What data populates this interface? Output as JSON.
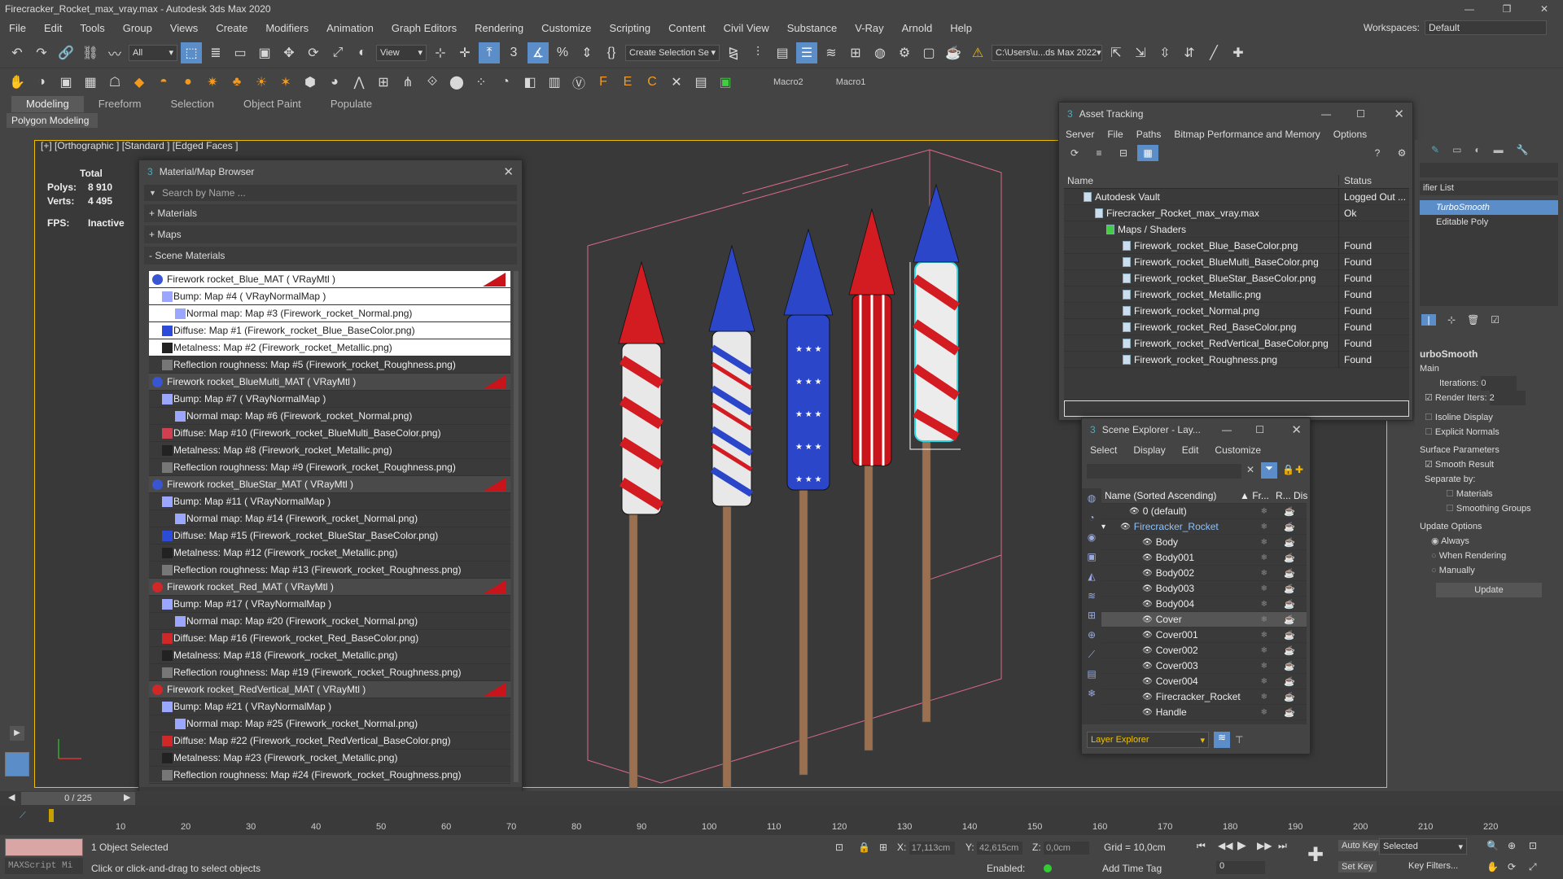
{
  "titlebar": {
    "title": "Firecracker_Rocket_max_vray.max - Autodesk 3ds Max 2020"
  },
  "menu": {
    "items": [
      "File",
      "Edit",
      "Tools",
      "Group",
      "Views",
      "Create",
      "Modifiers",
      "Animation",
      "Graph Editors",
      "Rendering",
      "Customize",
      "Scripting",
      "Content",
      "Civil View",
      "Substance",
      "V-Ray",
      "Arnold",
      "Help"
    ],
    "workspaces_label": "Workspaces:",
    "workspaces_value": "Default"
  },
  "toolbar": {
    "filter_value": "All",
    "view_value": "View",
    "selection_set_value": "Create Selection Se",
    "path_value": "C:\\Users\\u...ds Max 2022",
    "macro2": "Macro2",
    "macro1": "Macro1"
  },
  "ribbon": {
    "tabs": [
      "Modeling",
      "Freeform",
      "Selection",
      "Object Paint",
      "Populate"
    ],
    "sub_label": "Polygon Modeling"
  },
  "viewport": {
    "label": "[+] [Orthographic ] [Standard ] [Edged Faces ]",
    "stats": {
      "total_label": "Total",
      "polys_label": "Polys:",
      "polys": "8 910",
      "verts_label": "Verts:",
      "verts": "4 495",
      "fps_label": "FPS:",
      "fps": "Inactive"
    }
  },
  "material_browser": {
    "title": "Material/Map Browser",
    "search_placeholder": "Search by Name ...",
    "sections": [
      "+ Materials",
      "+ Maps",
      "- Scene Materials"
    ],
    "rows": [
      {
        "level": "mat",
        "text": "Firework rocket_Blue_MAT  ( VRayMtl )",
        "color": "#3a55d0",
        "hi": true
      },
      {
        "level": "lvl1",
        "text": "Bump: Map #4  ( VRayNormalMap )",
        "color": "#9aa6ff",
        "hi": true
      },
      {
        "level": "lvl2",
        "text": "Normal map: Map #3 (Firework_rocket_Normal.png)",
        "color": "#9aa6ff",
        "hi": true
      },
      {
        "level": "lvl1",
        "text": "Diffuse: Map #1 (Firework_rocket_Blue_BaseColor.png)",
        "color": "#2c4bd8",
        "hi": true
      },
      {
        "level": "lvl1",
        "text": "Metalness: Map #2 (Firework_rocket_Metallic.png)",
        "color": "#222222",
        "hi": true
      },
      {
        "level": "lvl1",
        "text": "Reflection roughness: Map #5 (Firework_rocket_Roughness.png)",
        "color": "#777777",
        "hi": false
      },
      {
        "level": "mat",
        "text": "Firework rocket_BlueMulti_MAT  ( VRayMtl )",
        "color": "#3a55d0",
        "hi": false
      },
      {
        "level": "lvl1",
        "text": "Bump: Map #7  ( VRayNormalMap )",
        "color": "#9aa6ff",
        "hi": false
      },
      {
        "level": "lvl2",
        "text": "Normal map: Map #6 (Firework_rocket_Normal.png)",
        "color": "#9aa6ff",
        "hi": false
      },
      {
        "level": "lvl1",
        "text": "Diffuse: Map #10 (Firework_rocket_BlueMulti_BaseColor.png)",
        "color": "#d04050",
        "hi": false
      },
      {
        "level": "lvl1",
        "text": "Metalness: Map #8 (Firework_rocket_Metallic.png)",
        "color": "#222222",
        "hi": false
      },
      {
        "level": "lvl1",
        "text": "Reflection roughness: Map #9 (Firework_rocket_Roughness.png)",
        "color": "#777777",
        "hi": false
      },
      {
        "level": "mat",
        "text": "Firework rocket_BlueStar_MAT  ( VRayMtl )",
        "color": "#3a55d0",
        "hi": false
      },
      {
        "level": "lvl1",
        "text": "Bump: Map #11  ( VRayNormalMap )",
        "color": "#9aa6ff",
        "hi": false
      },
      {
        "level": "lvl2",
        "text": "Normal map: Map #14 (Firework_rocket_Normal.png)",
        "color": "#9aa6ff",
        "hi": false
      },
      {
        "level": "lvl1",
        "text": "Diffuse: Map #15 (Firework_rocket_BlueStar_BaseColor.png)",
        "color": "#2c4bd8",
        "hi": false
      },
      {
        "level": "lvl1",
        "text": "Metalness: Map #12 (Firework_rocket_Metallic.png)",
        "color": "#222222",
        "hi": false
      },
      {
        "level": "lvl1",
        "text": "Reflection roughness: Map #13 (Firework_rocket_Roughness.png)",
        "color": "#777777",
        "hi": false
      },
      {
        "level": "mat",
        "text": "Firework rocket_Red_MAT  ( VRayMtl )",
        "color": "#d02828",
        "hi": false
      },
      {
        "level": "lvl1",
        "text": "Bump: Map #17  ( VRayNormalMap )",
        "color": "#9aa6ff",
        "hi": false
      },
      {
        "level": "lvl2",
        "text": "Normal map: Map #20 (Firework_rocket_Normal.png)",
        "color": "#9aa6ff",
        "hi": false
      },
      {
        "level": "lvl1",
        "text": "Diffuse: Map #16 (Firework_rocket_Red_BaseColor.png)",
        "color": "#d02828",
        "hi": false
      },
      {
        "level": "lvl1",
        "text": "Metalness: Map #18 (Firework_rocket_Metallic.png)",
        "color": "#222222",
        "hi": false
      },
      {
        "level": "lvl1",
        "text": "Reflection roughness: Map #19 (Firework_rocket_Roughness.png)",
        "color": "#777777",
        "hi": false
      },
      {
        "level": "mat",
        "text": "Firework rocket_RedVertical_MAT  ( VRayMtl )",
        "color": "#d02828",
        "hi": false
      },
      {
        "level": "lvl1",
        "text": "Bump: Map #21  ( VRayNormalMap )",
        "color": "#9aa6ff",
        "hi": false
      },
      {
        "level": "lvl2",
        "text": "Normal map: Map #25 (Firework_rocket_Normal.png)",
        "color": "#9aa6ff",
        "hi": false
      },
      {
        "level": "lvl1",
        "text": "Diffuse: Map #22 (Firework_rocket_RedVertical_BaseColor.png)",
        "color": "#d02828",
        "hi": false
      },
      {
        "level": "lvl1",
        "text": "Metalness: Map #23 (Firework_rocket_Metallic.png)",
        "color": "#222222",
        "hi": false
      },
      {
        "level": "lvl1",
        "text": "Reflection roughness: Map #24 (Firework_rocket_Roughness.png)",
        "color": "#777777",
        "hi": false
      }
    ]
  },
  "asset_tracking": {
    "title": "Asset Tracking",
    "menu": [
      "Server",
      "File",
      "Paths",
      "Bitmap Performance and Memory",
      "Options"
    ],
    "col_name": "Name",
    "col_status": "Status",
    "rows": [
      {
        "name": "Autodesk Vault",
        "status": "Logged Out ..."
      },
      {
        "name": "Firecracker_Rocket_max_vray.max",
        "status": "Ok"
      },
      {
        "name": "Maps / Shaders",
        "status": ""
      },
      {
        "name": "Firework_rocket_Blue_BaseColor.png",
        "status": "Found"
      },
      {
        "name": "Firework_rocket_BlueMulti_BaseColor.png",
        "status": "Found"
      },
      {
        "name": "Firework_rocket_BlueStar_BaseColor.png",
        "status": "Found"
      },
      {
        "name": "Firework_rocket_Metallic.png",
        "status": "Found"
      },
      {
        "name": "Firework_rocket_Normal.png",
        "status": "Found"
      },
      {
        "name": "Firework_rocket_Red_BaseColor.png",
        "status": "Found"
      },
      {
        "name": "Firework_rocket_RedVertical_BaseColor.png",
        "status": "Found"
      },
      {
        "name": "Firework_rocket_Roughness.png",
        "status": "Found"
      }
    ]
  },
  "scene_explorer": {
    "title": "Scene Explorer - Lay...",
    "menu": [
      "Select",
      "Display",
      "Edit",
      "Customize"
    ],
    "col_name": "Name (Sorted Ascending)",
    "col_fr": "▲ Fr...",
    "col_r": "R...",
    "col_dis": "Dis",
    "rows": [
      "0 (default)",
      "Firecracker_Rocket",
      "Body",
      "Body001",
      "Body002",
      "Body003",
      "Body004",
      "Cover",
      "Cover001",
      "Cover002",
      "Cover003",
      "Cover004",
      "Firecracker_Rocket",
      "Handle"
    ],
    "footer": "Layer Explorer"
  },
  "command_panel": {
    "modifier_list": "ifier List",
    "stack": [
      "TurboSmooth",
      "Editable Poly"
    ],
    "rollout_title": "urboSmooth",
    "main": "Main",
    "iterations_label": "Iterations:",
    "iterations": "0",
    "render_iters_label": "Render Iters:",
    "render_iters": "2",
    "isoline": "Isoline Display",
    "explicit": "Explicit Normals",
    "surface": "Surface Parameters",
    "smooth_result": "Smooth Result",
    "separate_by": "Separate by:",
    "materials": "Materials",
    "smoothing_groups": "Smoothing Groups",
    "update_options": "Update Options",
    "always": "Always",
    "when_rendering": "When Rendering",
    "manually": "Manually",
    "update": "Update"
  },
  "timeline": {
    "frame": "0 / 225",
    "ticks": [
      "10",
      "20",
      "30",
      "40",
      "50",
      "60",
      "70",
      "80",
      "90",
      "100",
      "110",
      "120",
      "130",
      "140",
      "150",
      "160",
      "170",
      "180",
      "190",
      "200",
      "210",
      "220"
    ]
  },
  "status": {
    "maxscript": "MAXScript Mi",
    "selected": "1 Object Selected",
    "hint": "Click or click-and-drag to select objects",
    "x_label": "X:",
    "x": "17,113cm",
    "y_label": "Y:",
    "y": "42,615cm",
    "z_label": "Z:",
    "z": "0,0cm",
    "grid": "Grid = 10,0cm",
    "enabled": "Enabled:",
    "add_time_tag": "Add Time Tag",
    "auto_key": "Auto Key",
    "set_key": "Set Key",
    "selected_combo": "Selected",
    "key_filters": "Key Filters...",
    "frame_field": "0"
  }
}
